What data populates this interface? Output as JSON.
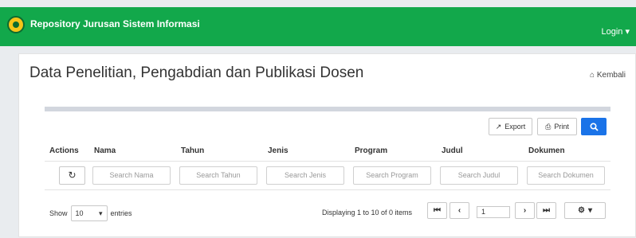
{
  "navbar": {
    "brand": "Repository Jurusan Sistem Informasi",
    "login": "Login ▾"
  },
  "page": {
    "title": "Data Penelitian, Pengabdian dan Publikasi Dosen",
    "back": "Kembali"
  },
  "toolbar": {
    "export": "Export",
    "print": "Print"
  },
  "table": {
    "columns": [
      "Actions",
      "Nama",
      "Tahun",
      "Jenis",
      "Program",
      "Judul",
      "Dokumen"
    ],
    "search_placeholders": [
      "Search Nama",
      "Search Tahun",
      "Search Jenis",
      "Search Program",
      "Search Judul",
      "Search Dokumen"
    ]
  },
  "footer": {
    "show": "Show",
    "page_size": "10",
    "entries": "entries",
    "displaying": "Displaying 1 to 10 of 0 items",
    "current_page": "1"
  },
  "colors": {
    "navbar": "#12a84b",
    "primary": "#1a73e8"
  }
}
